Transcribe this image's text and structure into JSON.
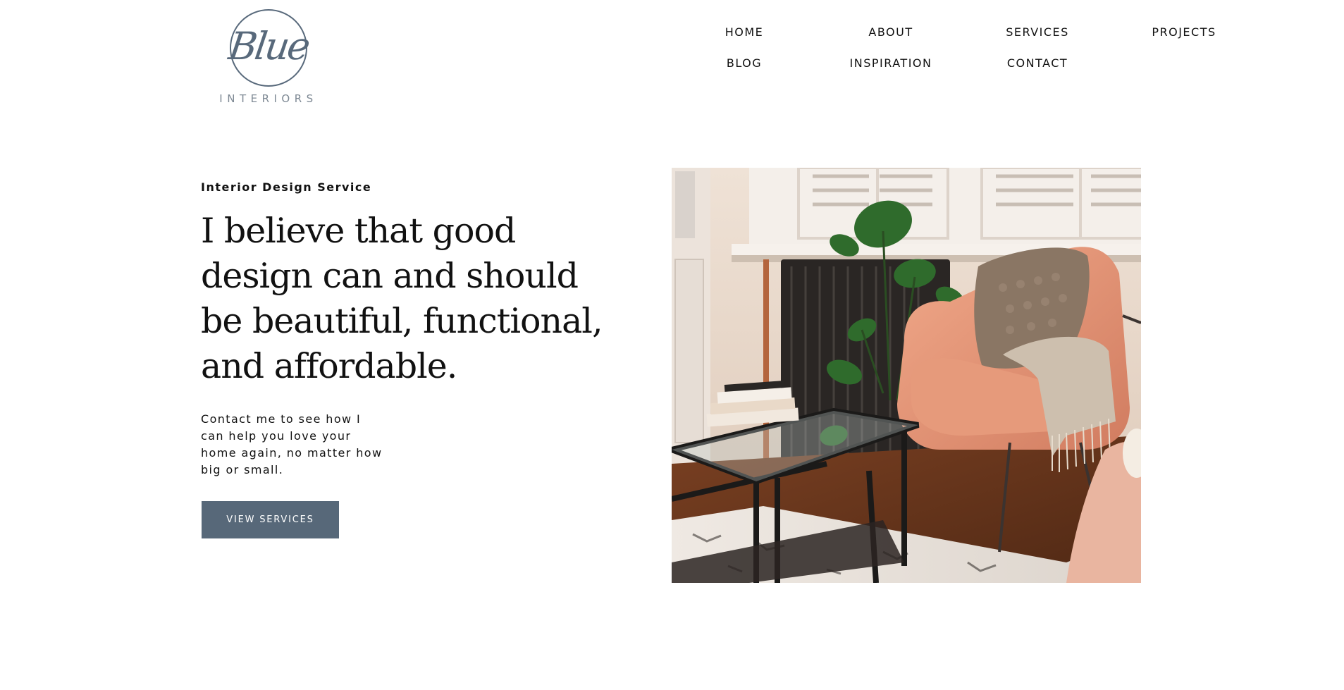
{
  "brand": {
    "logo_script": "Blue",
    "logo_subtitle": "INTERIORS"
  },
  "nav": {
    "items": [
      {
        "label": "HOME"
      },
      {
        "label": "ABOUT"
      },
      {
        "label": "SERVICES"
      },
      {
        "label": "PROJECTS"
      },
      {
        "label": "BLOG"
      },
      {
        "label": "INSPIRATION"
      },
      {
        "label": "CONTACT"
      }
    ]
  },
  "hero": {
    "eyebrow": "Interior Design Service",
    "headline_lines": [
      "I believe that good",
      "design can and should",
      "be beautiful, functional,",
      "and affordable."
    ],
    "body_lines": [
      "Contact me to see how I",
      "can help you love your",
      "home again, no matter how",
      "big or small."
    ],
    "cta_label": "VIEW SERVICES",
    "accent_color": "#576879"
  },
  "photo": {
    "subject": "living-room-armchair-photo"
  }
}
